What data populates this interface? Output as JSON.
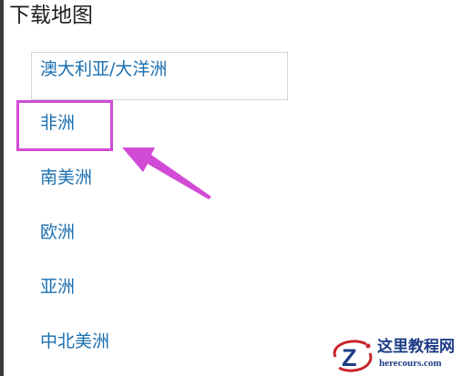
{
  "page": {
    "title": "下载地图"
  },
  "regions": [
    {
      "label": "澳大利亚/大洋洲",
      "selected": true
    },
    {
      "label": "非洲",
      "selected": false
    },
    {
      "label": "南美洲",
      "selected": false
    },
    {
      "label": "欧洲",
      "selected": false
    },
    {
      "label": "亚洲",
      "selected": false
    },
    {
      "label": "中北美洲",
      "selected": false
    }
  ],
  "annotation": {
    "highlight_color": "#d24bd6",
    "highlight_target": "非洲",
    "arrow_color": "#d24bd6"
  },
  "colors": {
    "link": "#1a6fb0",
    "title": "#1f1f1f",
    "selected_border": "#cfd6dc"
  },
  "watermark": {
    "name": "这里教程网",
    "site": "herecours.com",
    "logo_letter": "Z"
  }
}
